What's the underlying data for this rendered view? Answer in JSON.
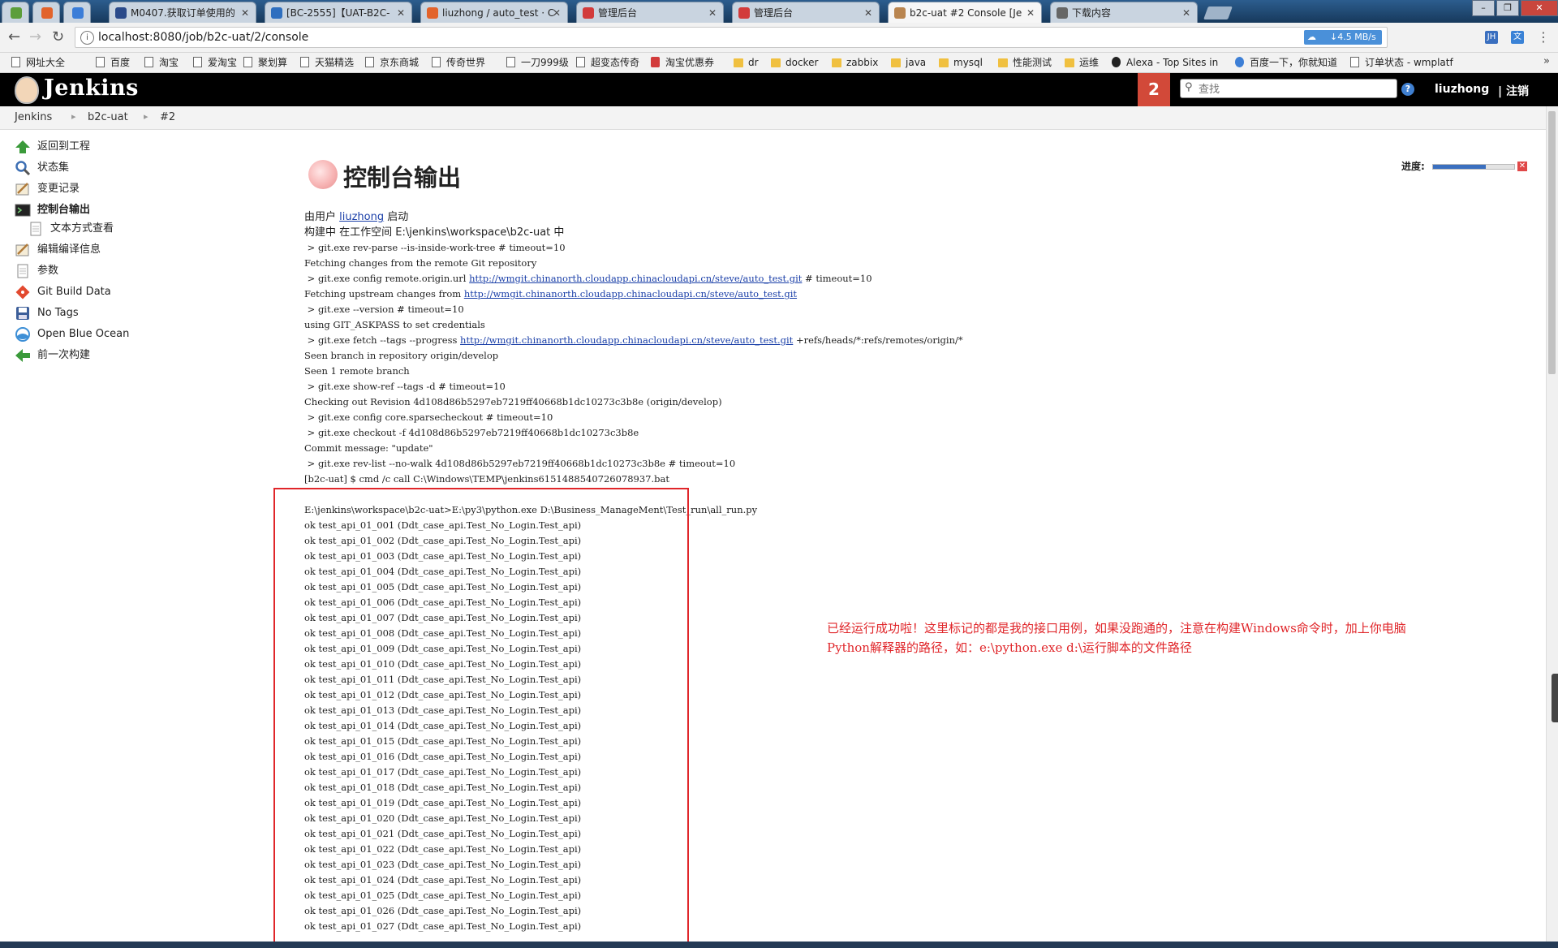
{
  "browser": {
    "tabs": [
      {
        "label": "",
        "pinned": true,
        "color": "#5c9e3a"
      },
      {
        "label": "",
        "pinned": true,
        "color": "#e2632b"
      },
      {
        "label": "",
        "pinned": true,
        "color": "#3b7dd8"
      },
      {
        "label": "M0407.获取订单使用的",
        "color": "#2a4a8a"
      },
      {
        "label": "[BC-2555]【UAT-B2C-",
        "color": "#2f6fbf"
      },
      {
        "label": "liuzhong / auto_test · C",
        "color": "#e2632b"
      },
      {
        "label": "管理后台",
        "color": "#d23b3b"
      },
      {
        "label": "管理后台",
        "color": "#d23b3b"
      },
      {
        "label": "b2c-uat #2 Console [Je",
        "color": "#b9854f",
        "active": true
      },
      {
        "label": "下载内容",
        "color": "#666666"
      }
    ],
    "url": "localhost:8080/job/b2c-uat/2/console",
    "download_speed": "↓4.5 MB/s",
    "bookmarks": [
      {
        "label": "网址大全",
        "icon": "page"
      },
      {
        "label": "百度",
        "icon": "page"
      },
      {
        "label": "淘宝",
        "icon": "page"
      },
      {
        "label": "爱淘宝",
        "icon": "page"
      },
      {
        "label": "聚划算",
        "icon": "page"
      },
      {
        "label": "天猫精选",
        "icon": "page"
      },
      {
        "label": "京东商城",
        "icon": "page"
      },
      {
        "label": "传奇世界",
        "icon": "page"
      },
      {
        "label": "一刀999级",
        "icon": "page"
      },
      {
        "label": "超变态传奇",
        "icon": "page"
      },
      {
        "label": "淘宝优惠券",
        "icon": "red"
      },
      {
        "label": "dr",
        "icon": "folder"
      },
      {
        "label": "docker",
        "icon": "folder"
      },
      {
        "label": "zabbix",
        "icon": "folder"
      },
      {
        "label": "java",
        "icon": "folder"
      },
      {
        "label": "mysql",
        "icon": "folder"
      },
      {
        "label": "性能测试",
        "icon": "folder"
      },
      {
        "label": "运维",
        "icon": "folder"
      },
      {
        "label": "Alexa - Top Sites in",
        "icon": "round"
      },
      {
        "label": "百度一下，你就知道",
        "icon": "blue"
      },
      {
        "label": "订单状态 - wmplatf",
        "icon": "page"
      }
    ],
    "bookmarks_more": "»"
  },
  "header": {
    "logo_text": "Jenkins",
    "notification_count": "2",
    "search_placeholder": "查找",
    "help": "?",
    "username": "liuzhong",
    "logout": "| 注销"
  },
  "breadcrumb": [
    "Jenkins",
    "b2c-uat",
    "#2"
  ],
  "sidebar": {
    "items": [
      {
        "label": "返回到工程",
        "icon": "up-arrow-icon",
        "color": "#3a9a3a"
      },
      {
        "label": "状态集",
        "icon": "magnifier-icon",
        "color": "#3d6fb4"
      },
      {
        "label": "变更记录",
        "icon": "notepad-icon",
        "color": "#b07a3a"
      },
      {
        "label": "控制台输出",
        "icon": "terminal-icon",
        "color": "#222222",
        "current": true
      },
      {
        "label": "文本方式查看",
        "icon": "document-icon",
        "color": "#888888",
        "sub": true
      },
      {
        "label": "编辑编译信息",
        "icon": "notepad-icon",
        "color": "#b07a3a"
      },
      {
        "label": "参数",
        "icon": "document-icon",
        "color": "#888888"
      },
      {
        "label": "Git Build Data",
        "icon": "git-icon",
        "color": "#e2492f"
      },
      {
        "label": "No Tags",
        "icon": "floppy-icon",
        "color": "#3d5f9a"
      },
      {
        "label": "Open Blue Ocean",
        "icon": "blue-ocean-icon",
        "color": "#3d8fd6"
      },
      {
        "label": "前一次构建",
        "icon": "left-arrow-icon",
        "color": "#3a9a3a"
      }
    ]
  },
  "main": {
    "title": "控制台输出",
    "progress_label": "进度:",
    "progress_value": 0.65,
    "console_lines": [
      {
        "segments": [
          {
            "t": "由用户 "
          },
          {
            "t": "liuzhong",
            "link": true
          },
          {
            "t": " 启动"
          }
        ],
        "cjk": true
      },
      {
        "segments": [
          {
            "t": "构建中 在工作空间 E:\\jenkins\\workspace\\b2c-uat 中"
          }
        ],
        "cjk": true
      },
      {
        "segments": [
          {
            "t": " > git.exe rev-parse --is-inside-work-tree # timeout=10"
          }
        ]
      },
      {
        "segments": [
          {
            "t": "Fetching changes from the remote Git repository"
          }
        ]
      },
      {
        "segments": [
          {
            "t": " > git.exe config remote.origin.url "
          },
          {
            "t": "http://wmgit.chinanorth.cloudapp.chinacloudapi.cn/steve/auto_test.git",
            "link": true
          },
          {
            "t": " # timeout=10"
          }
        ]
      },
      {
        "segments": [
          {
            "t": "Fetching upstream changes from "
          },
          {
            "t": "http://wmgit.chinanorth.cloudapp.chinacloudapi.cn/steve/auto_test.git",
            "link": true
          }
        ]
      },
      {
        "segments": [
          {
            "t": " > git.exe --version # timeout=10"
          }
        ]
      },
      {
        "segments": [
          {
            "t": "using GIT_ASKPASS to set credentials"
          }
        ]
      },
      {
        "segments": [
          {
            "t": " > git.exe fetch --tags --progress "
          },
          {
            "t": "http://wmgit.chinanorth.cloudapp.chinacloudapi.cn/steve/auto_test.git",
            "link": true
          },
          {
            "t": " +refs/heads/*:refs/remotes/origin/*"
          }
        ]
      },
      {
        "segments": [
          {
            "t": "Seen branch in repository origin/develop"
          }
        ]
      },
      {
        "segments": [
          {
            "t": "Seen 1 remote branch"
          }
        ]
      },
      {
        "segments": [
          {
            "t": " > git.exe show-ref --tags -d # timeout=10"
          }
        ]
      },
      {
        "segments": [
          {
            "t": "Checking out Revision 4d108d86b5297eb7219ff40668b1dc10273c3b8e (origin/develop)"
          }
        ]
      },
      {
        "segments": [
          {
            "t": " > git.exe config core.sparsecheckout # timeout=10"
          }
        ]
      },
      {
        "segments": [
          {
            "t": " > git.exe checkout -f 4d108d86b5297eb7219ff40668b1dc10273c3b8e"
          }
        ]
      },
      {
        "segments": [
          {
            "t": "Commit message: \"update\""
          }
        ]
      },
      {
        "segments": [
          {
            "t": " > git.exe rev-list --no-walk 4d108d86b5297eb7219ff40668b1dc10273c3b8e # timeout=10"
          }
        ]
      },
      {
        "segments": [
          {
            "t": "[b2c-uat] $ cmd /c call C:\\Windows\\TEMP\\jenkins6151488540726078937.bat"
          }
        ]
      },
      {
        "segments": [
          {
            "t": ""
          }
        ]
      },
      {
        "segments": [
          {
            "t": "E:\\jenkins\\workspace\\b2c-uat>E:\\py3\\python.exe D:\\Business_ManageMent\\Test_run\\all_run.py"
          }
        ]
      },
      {
        "segments": [
          {
            "t": "ok test_api_01_001 (Ddt_case_api.Test_No_Login.Test_api)"
          }
        ]
      },
      {
        "segments": [
          {
            "t": "ok test_api_01_002 (Ddt_case_api.Test_No_Login.Test_api)"
          }
        ]
      },
      {
        "segments": [
          {
            "t": "ok test_api_01_003 (Ddt_case_api.Test_No_Login.Test_api)"
          }
        ]
      },
      {
        "segments": [
          {
            "t": "ok test_api_01_004 (Ddt_case_api.Test_No_Login.Test_api)"
          }
        ]
      },
      {
        "segments": [
          {
            "t": "ok test_api_01_005 (Ddt_case_api.Test_No_Login.Test_api)"
          }
        ]
      },
      {
        "segments": [
          {
            "t": "ok test_api_01_006 (Ddt_case_api.Test_No_Login.Test_api)"
          }
        ]
      },
      {
        "segments": [
          {
            "t": "ok test_api_01_007 (Ddt_case_api.Test_No_Login.Test_api)"
          }
        ]
      },
      {
        "segments": [
          {
            "t": "ok test_api_01_008 (Ddt_case_api.Test_No_Login.Test_api)"
          }
        ]
      },
      {
        "segments": [
          {
            "t": "ok test_api_01_009 (Ddt_case_api.Test_No_Login.Test_api)"
          }
        ]
      },
      {
        "segments": [
          {
            "t": "ok test_api_01_010 (Ddt_case_api.Test_No_Login.Test_api)"
          }
        ]
      },
      {
        "segments": [
          {
            "t": "ok test_api_01_011 (Ddt_case_api.Test_No_Login.Test_api)"
          }
        ]
      },
      {
        "segments": [
          {
            "t": "ok test_api_01_012 (Ddt_case_api.Test_No_Login.Test_api)"
          }
        ]
      },
      {
        "segments": [
          {
            "t": "ok test_api_01_013 (Ddt_case_api.Test_No_Login.Test_api)"
          }
        ]
      },
      {
        "segments": [
          {
            "t": "ok test_api_01_014 (Ddt_case_api.Test_No_Login.Test_api)"
          }
        ]
      },
      {
        "segments": [
          {
            "t": "ok test_api_01_015 (Ddt_case_api.Test_No_Login.Test_api)"
          }
        ]
      },
      {
        "segments": [
          {
            "t": "ok test_api_01_016 (Ddt_case_api.Test_No_Login.Test_api)"
          }
        ]
      },
      {
        "segments": [
          {
            "t": "ok test_api_01_017 (Ddt_case_api.Test_No_Login.Test_api)"
          }
        ]
      },
      {
        "segments": [
          {
            "t": "ok test_api_01_018 (Ddt_case_api.Test_No_Login.Test_api)"
          }
        ]
      },
      {
        "segments": [
          {
            "t": "ok test_api_01_019 (Ddt_case_api.Test_No_Login.Test_api)"
          }
        ]
      },
      {
        "segments": [
          {
            "t": "ok test_api_01_020 (Ddt_case_api.Test_No_Login.Test_api)"
          }
        ]
      },
      {
        "segments": [
          {
            "t": "ok test_api_01_021 (Ddt_case_api.Test_No_Login.Test_api)"
          }
        ]
      },
      {
        "segments": [
          {
            "t": "ok test_api_01_022 (Ddt_case_api.Test_No_Login.Test_api)"
          }
        ]
      },
      {
        "segments": [
          {
            "t": "ok test_api_01_023 (Ddt_case_api.Test_No_Login.Test_api)"
          }
        ]
      },
      {
        "segments": [
          {
            "t": "ok test_api_01_024 (Ddt_case_api.Test_No_Login.Test_api)"
          }
        ]
      },
      {
        "segments": [
          {
            "t": "ok test_api_01_025 (Ddt_case_api.Test_No_Login.Test_api)"
          }
        ]
      },
      {
        "segments": [
          {
            "t": "ok test_api_01_026 (Ddt_case_api.Test_No_Login.Test_api)"
          }
        ]
      },
      {
        "segments": [
          {
            "t": "ok test_api_01_027 (Ddt_case_api.Test_No_Login.Test_api)"
          }
        ]
      }
    ],
    "annotation_lines": [
      "已经运行成功啦！这里标记的都是我的接口用例，如果没跑通的，注意在构建Windows命令时，加上你电脑",
      "Python解释器的路径，如：e:\\python.exe  d:\\运行脚本的文件路径"
    ]
  },
  "colors": {
    "jenkins_header": "#000000",
    "badge_red": "#d24939",
    "link": "#1a3fa8",
    "annotation_red": "#e0262a"
  }
}
